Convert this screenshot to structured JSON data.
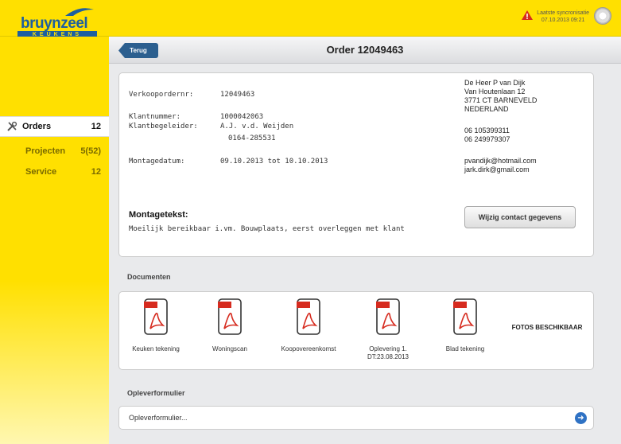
{
  "brand": {
    "name": "bruynzeel",
    "sub": "KEUKENS"
  },
  "sync": {
    "line1": "Laatste syncronisatie",
    "line2": "07.10.2013 09:21"
  },
  "sidebar": {
    "items": [
      {
        "label": "Orders",
        "count": "12",
        "icon": "wrench-icon"
      },
      {
        "label": "Projecten",
        "count": "5(52)"
      },
      {
        "label": "Service",
        "count": "12"
      }
    ]
  },
  "header": {
    "back": "Terug",
    "title": "Order 12049463"
  },
  "order": {
    "verkooporder_label": "Verkoopordernr:",
    "verkooporder": "12049463",
    "klantnummer_label": "Klantnummer:",
    "klantnummer": "1000042063",
    "klantbegeleider_label": "Klantbegeleider:",
    "klantbegeleider": "A.J. v.d. Weijden",
    "klantbegeleider_tel": "0164-285531",
    "montagedatum_label": "Montagedatum:",
    "montagedatum": "09.10.2013 tot 10.10.2013",
    "montagetekst_label": "Montagetekst:",
    "montagetekst": "Moeilijk bereikbaar i.vm. Bouwplaats, eerst overleggen met klant",
    "edit_button": "Wijzig contact gegevens"
  },
  "contact": {
    "name": "De Heer P van Dijk",
    "street": "Van Houtenlaan 12",
    "city": "3771 CT BARNEVELD",
    "country": "NEDERLAND",
    "phone1": "06 105399311",
    "phone2": "06 249979307",
    "email1": "pvandijk@hotmail.com",
    "email2": "jark.dirk@gmail.com"
  },
  "documents": {
    "title": "Documenten",
    "items": [
      {
        "name": "Keuken tekening",
        "badge": "PDF"
      },
      {
        "name": "Woningscan",
        "badge": "PDF"
      },
      {
        "name": "Koopovereenkomst",
        "badge": "PDF"
      },
      {
        "name": "Oplevering 1. DT:23.08.2013",
        "badge": "PDF"
      },
      {
        "name": "Blad tekening",
        "badge": "PDF"
      }
    ],
    "fotos": "FOTOS BESCHIKBAAR"
  },
  "oplever": {
    "title": "Opleverformulier",
    "field": "Opleverformulier..."
  },
  "colors": {
    "brand_yellow": "#ffe000",
    "brand_blue": "#1d5fa0",
    "pdf_red": "#d62b1f"
  }
}
